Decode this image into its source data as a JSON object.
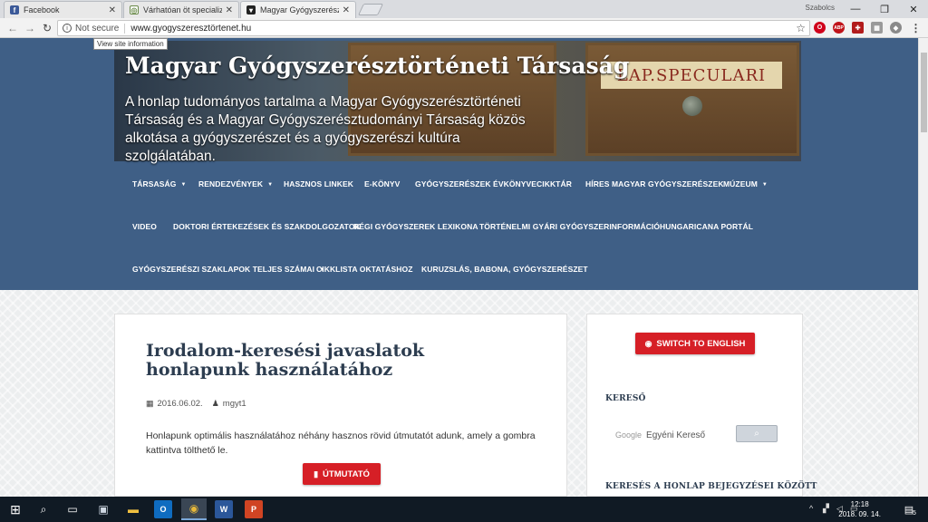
{
  "browser": {
    "tabs": [
      {
        "title": "Facebook",
        "icon": "facebook-icon",
        "active": false
      },
      {
        "title": "Várhatóan öt specializáció",
        "icon": "site-icon",
        "active": false
      },
      {
        "title": "Magyar Gyógyszerésztört",
        "icon": "site-icon",
        "active": true
      }
    ],
    "profile_name": "Szabolcs",
    "address": {
      "security_label": "Not secure",
      "url": "www.gyogyszeresztörtenet.hu",
      "tooltip": "View site information"
    },
    "extensions": [
      "opera-icon",
      "adblock-icon",
      "extension-icon",
      "extension-icon",
      "shield-icon",
      "menu-icon"
    ],
    "extension_labels": {
      "adblock": "ABP"
    }
  },
  "site": {
    "title": "Magyar Gyógyszerésztörténeti Társaság",
    "description": "A honlap tudományos tartalma a Magyar Gyógyszerésztörténeti Társaság és a Magyar Gyógyszerésztudományi Társaság közös alkotása a gyógyszerészet és a gyógyszerészi kultúra szolgálatában.",
    "hero_label": "LAP.SPECULARI",
    "nav": [
      {
        "label": "TÁRSASÁG",
        "dropdown": true
      },
      {
        "label": "RENDEZVÉNYEK",
        "dropdown": true
      },
      {
        "label": "HASZNOS LINKEK",
        "dropdown": false
      },
      {
        "label": "E-KÖNYV",
        "dropdown": false
      },
      {
        "label": "GYÓGYSZERÉSZEK ÉVKÖNYVE",
        "dropdown": false
      },
      {
        "label": "CIKKTÁR",
        "dropdown": false
      },
      {
        "label": "HÍRES MAGYAR GYÓGYSZERÉSZEK",
        "dropdown": false
      },
      {
        "label": "MÚZEUM",
        "dropdown": true
      },
      {
        "label": "VIDEO",
        "dropdown": false
      },
      {
        "label": "DOKTORI ÉRTEKEZÉSEK ÉS SZAKDOLGOZATOK",
        "dropdown": false
      },
      {
        "label": "RÉGI GYÓGYSZEREK LEXIKONA",
        "dropdown": false
      },
      {
        "label": "TÖRTÉNELMI GYÁRI GYÓGYSZERINFORMÁCIÓ",
        "dropdown": false
      },
      {
        "label": "HUNGARICANA PORTÁL",
        "dropdown": false
      },
      {
        "label": "GYÓGYSZERÉSZI SZAKLAPOK TELJES SZÁMAI",
        "dropdown": true
      },
      {
        "label": "CIKKLISTA OKTATÁSHOZ",
        "dropdown": false
      },
      {
        "label": "KURUZSLÁS, BABONA, GYÓGYSZERÉSZET",
        "dropdown": false
      }
    ]
  },
  "post": {
    "title": "Irodalom-keresési javaslatok honlapunk használatához",
    "date": "2016.06.02.",
    "author": "mgyt1",
    "excerpt": "Honlapunk optimális használatához néhány hasznos rövid útmutatót adunk, amely a gombra kattintva tölthető le.",
    "button_label": "ÚTMUTATÓ"
  },
  "sidebar": {
    "english_button": "SWITCH TO ENGLISH",
    "search_title": "KERESŐ",
    "search_placeholder_brand": "Google",
    "search_placeholder": "Egyéni Kereső",
    "second_title": "KERESÉS A HONLAP BEJEGYZÉSEI KÖZÖTT"
  },
  "taskbar": {
    "time": "12:18",
    "date": "2018. 09. 14.",
    "notification_count": "5"
  },
  "colors": {
    "header_bg": "#3f5f86",
    "accent_red": "#d61f26",
    "title_color": "#2d3d50",
    "taskbar_bg": "#101a24"
  }
}
